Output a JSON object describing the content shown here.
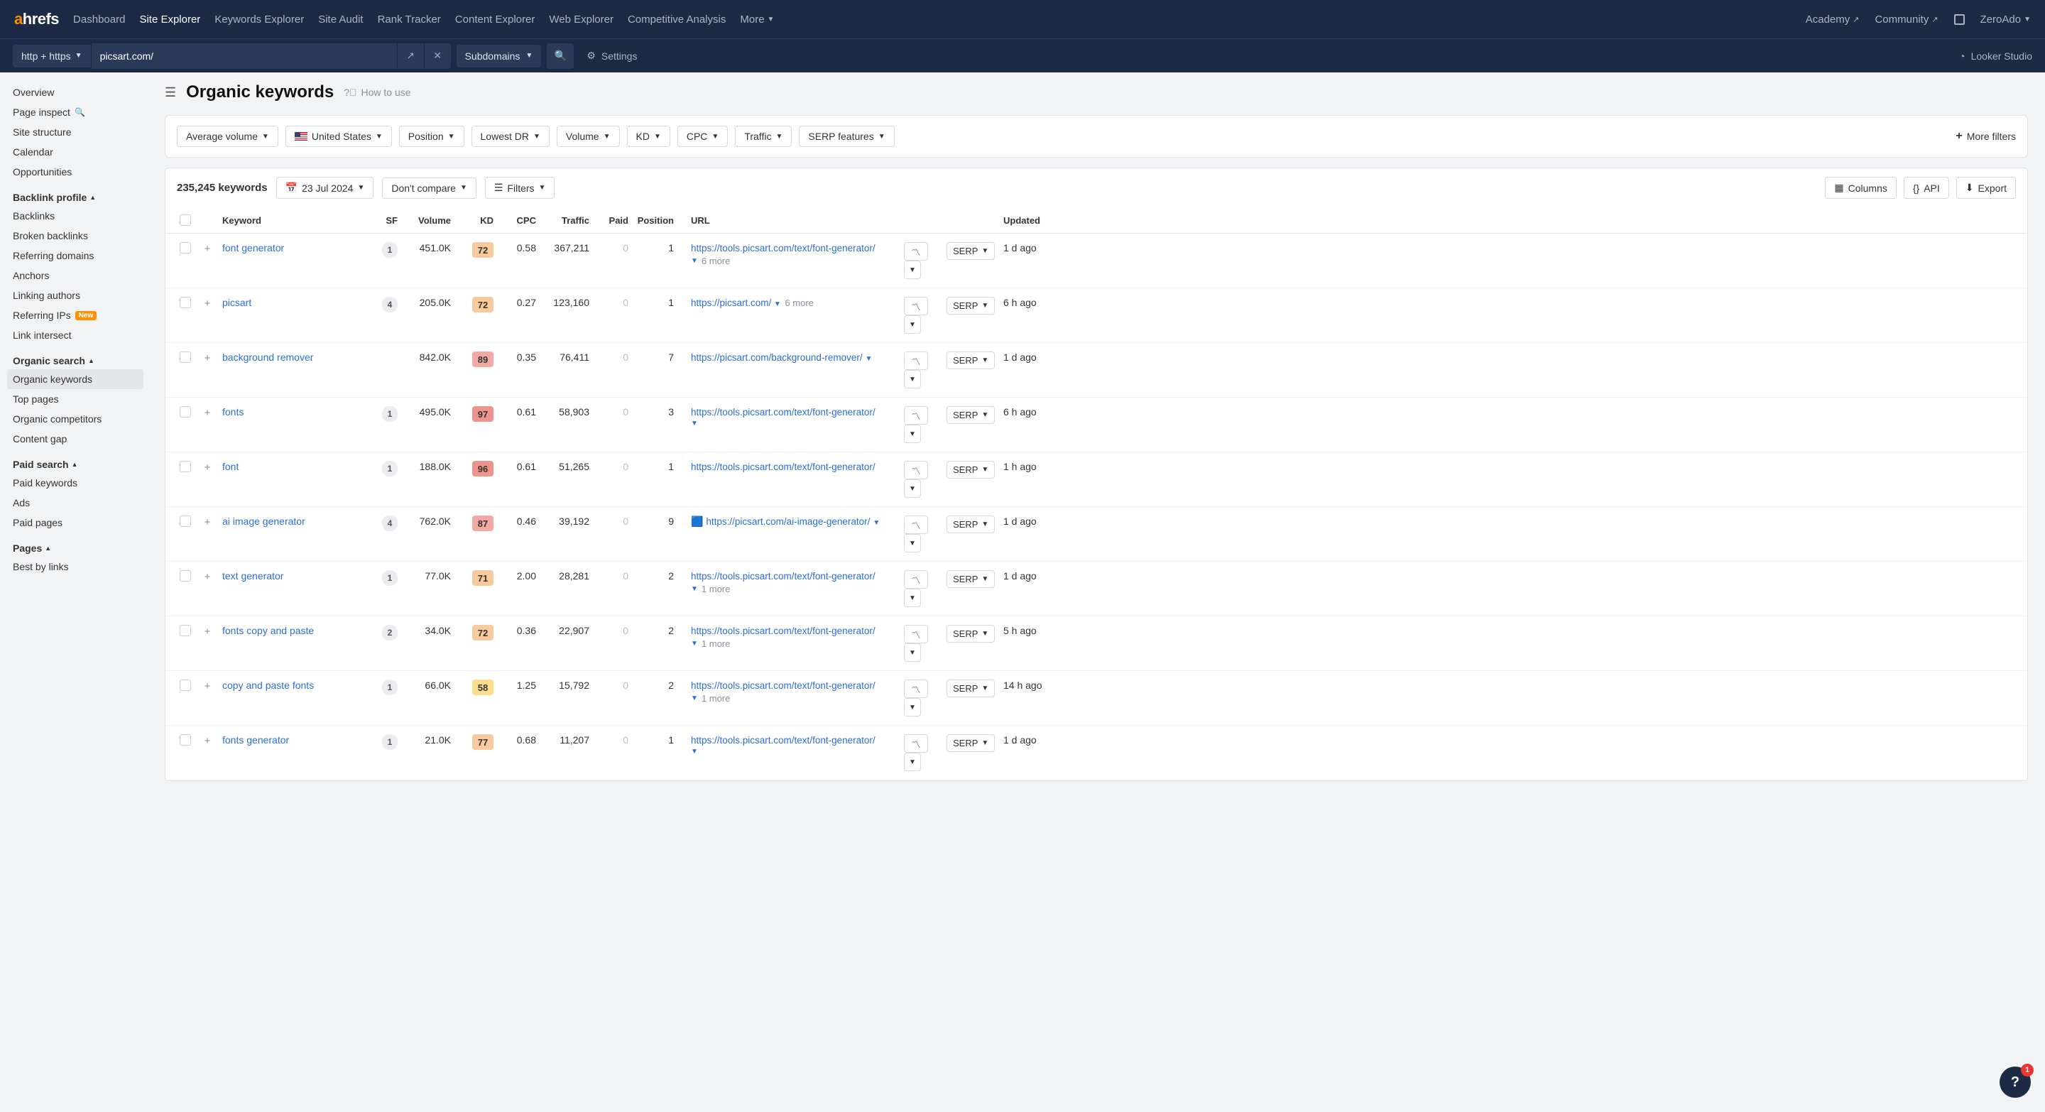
{
  "nav": {
    "items": [
      "Dashboard",
      "Site Explorer",
      "Keywords Explorer",
      "Site Audit",
      "Rank Tracker",
      "Content Explorer",
      "Web Explorer",
      "Competitive Analysis",
      "More"
    ],
    "activeIndex": 1,
    "right": {
      "academy": "Academy",
      "community": "Community",
      "account": "ZeroAdo"
    }
  },
  "controls": {
    "protocol": "http + https",
    "url": "picsart.com/",
    "mode": "Subdomains",
    "settings": "Settings",
    "looker": "Looker Studio"
  },
  "sidebar": {
    "top": [
      "Overview",
      "Page inspect",
      "Site structure",
      "Calendar",
      "Opportunities"
    ],
    "sections": [
      {
        "title": "Backlink profile",
        "items": [
          {
            "label": "Backlinks"
          },
          {
            "label": "Broken backlinks"
          },
          {
            "label": "Referring domains"
          },
          {
            "label": "Anchors"
          },
          {
            "label": "Linking authors"
          },
          {
            "label": "Referring IPs",
            "new": true
          },
          {
            "label": "Link intersect"
          }
        ]
      },
      {
        "title": "Organic search",
        "items": [
          {
            "label": "Organic keywords",
            "active": true
          },
          {
            "label": "Top pages"
          },
          {
            "label": "Organic competitors"
          },
          {
            "label": "Content gap"
          }
        ]
      },
      {
        "title": "Paid search",
        "items": [
          {
            "label": "Paid keywords"
          },
          {
            "label": "Ads"
          },
          {
            "label": "Paid pages"
          }
        ]
      },
      {
        "title": "Pages",
        "items": [
          {
            "label": "Best by links"
          }
        ]
      }
    ]
  },
  "page": {
    "title": "Organic keywords",
    "howto": "How to use",
    "count": "235,245 keywords",
    "date": "23 Jul 2024",
    "compare": "Don't compare",
    "filters_btn": "Filters",
    "columns_btn": "Columns",
    "api_btn": "API",
    "export_btn": "Export",
    "more_filters": "More filters",
    "filters": [
      "Average volume",
      "United States",
      "Position",
      "Lowest DR",
      "Volume",
      "KD",
      "CPC",
      "Traffic",
      "SERP features"
    ]
  },
  "columns": {
    "keyword": "Keyword",
    "sf": "SF",
    "volume": "Volume",
    "kd": "KD",
    "cpc": "CPC",
    "traffic": "Traffic",
    "paid": "Paid",
    "position": "Position",
    "url": "URL",
    "updated": "Updated",
    "serp": "SERP"
  },
  "kdColors": {
    "72": "#f8c99c",
    "89": "#f2a9a4",
    "97": "#ef938e",
    "96": "#ef938e",
    "87": "#f2a9a4",
    "71": "#f8c99c",
    "58": "#fade8c",
    "77": "#f8c99c"
  },
  "rows": [
    {
      "keyword": "font generator",
      "sf": "1",
      "volume": "451.0K",
      "kd": "72",
      "cpc": "0.58",
      "traffic": "367,211",
      "paid": "0",
      "position": "1",
      "url": "https://tools.picsart.com/text/font-generator/",
      "more": "6 more",
      "updated": "1 d ago"
    },
    {
      "keyword": "picsart",
      "sf": "4",
      "volume": "205.0K",
      "kd": "72",
      "cpc": "0.27",
      "traffic": "123,160",
      "paid": "0",
      "position": "1",
      "url": "https://picsart.com/",
      "moreInline": "6 more",
      "updated": "6 h ago"
    },
    {
      "keyword": "background remover",
      "sf": "",
      "volume": "842.0K",
      "kd": "89",
      "cpc": "0.35",
      "traffic": "76,411",
      "paid": "0",
      "position": "7",
      "url": "https://picsart.com/background-remover/",
      "dropdownInline": true,
      "updated": "1 d ago"
    },
    {
      "keyword": "fonts",
      "sf": "1",
      "volume": "495.0K",
      "kd": "97",
      "cpc": "0.61",
      "traffic": "58,903",
      "paid": "0",
      "position": "3",
      "url": "https://tools.picsart.com/text/font-generator/",
      "dropdown": true,
      "updated": "6 h ago"
    },
    {
      "keyword": "font",
      "sf": "1",
      "volume": "188.0K",
      "kd": "96",
      "cpc": "0.61",
      "traffic": "51,265",
      "paid": "0",
      "position": "1",
      "url": "https://tools.picsart.com/text/font-generator/",
      "updated": "1 h ago"
    },
    {
      "keyword": "ai image generator",
      "sf": "4",
      "volume": "762.0K",
      "kd": "87",
      "cpc": "0.46",
      "traffic": "39,192",
      "paid": "0",
      "position": "9",
      "url": "https://picsart.com/ai-image-generator/",
      "dropdownInline": true,
      "iconPrefix": true,
      "updated": "1 d ago"
    },
    {
      "keyword": "text generator",
      "sf": "1",
      "volume": "77.0K",
      "kd": "71",
      "cpc": "2.00",
      "traffic": "28,281",
      "paid": "0",
      "position": "2",
      "url": "https://tools.picsart.com/text/font-generator/",
      "more": "1 more",
      "updated": "1 d ago"
    },
    {
      "keyword": "fonts copy and paste",
      "sf": "2",
      "volume": "34.0K",
      "kd": "72",
      "cpc": "0.36",
      "traffic": "22,907",
      "paid": "0",
      "position": "2",
      "url": "https://tools.picsart.com/text/font-generator/",
      "more": "1 more",
      "updated": "5 h ago"
    },
    {
      "keyword": "copy and paste fonts",
      "sf": "1",
      "volume": "66.0K",
      "kd": "58",
      "cpc": "1.25",
      "traffic": "15,792",
      "paid": "0",
      "position": "2",
      "url": "https://tools.picsart.com/text/font-generator/",
      "more": "1 more",
      "updated": "14 h ago"
    },
    {
      "keyword": "fonts generator",
      "sf": "1",
      "volume": "21.0K",
      "kd": "77",
      "cpc": "0.68",
      "traffic": "11,207",
      "paid": "0",
      "position": "1",
      "url": "https://tools.picsart.com/text/font-generator/",
      "dropdown": true,
      "updated": "1 d ago"
    }
  ],
  "help_badge": "1"
}
